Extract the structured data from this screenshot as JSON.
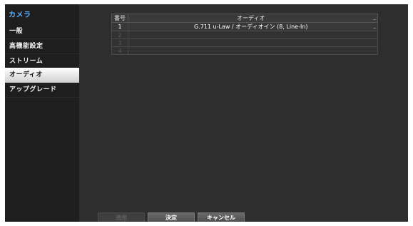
{
  "sidebar": {
    "title": "カメラ",
    "items": [
      {
        "label": "一般"
      },
      {
        "label": "高機能設定"
      },
      {
        "label": "ストリーム"
      },
      {
        "label": "オーディオ",
        "selected": true
      },
      {
        "label": "アップグレード"
      }
    ]
  },
  "table": {
    "headers": [
      "番号",
      "オーディオ"
    ],
    "rows": [
      {
        "num": "1",
        "audio": "G.711 u-Law / オーディオイン (8, Line-In)",
        "mark": "_",
        "enabled": true
      },
      {
        "num": "2",
        "audio": "",
        "enabled": false
      },
      {
        "num": "3",
        "audio": "",
        "enabled": false
      },
      {
        "num": "4",
        "audio": "",
        "enabled": false
      }
    ],
    "header_mark": "_"
  },
  "footer": {
    "apply_label": "適用",
    "ok_label": "決定",
    "cancel_label": "キャンセル"
  },
  "colors": {
    "accent": "#5fb0ff",
    "sidebar_bg": "#1e1e1e",
    "main_bg": "#2e2e2e"
  }
}
